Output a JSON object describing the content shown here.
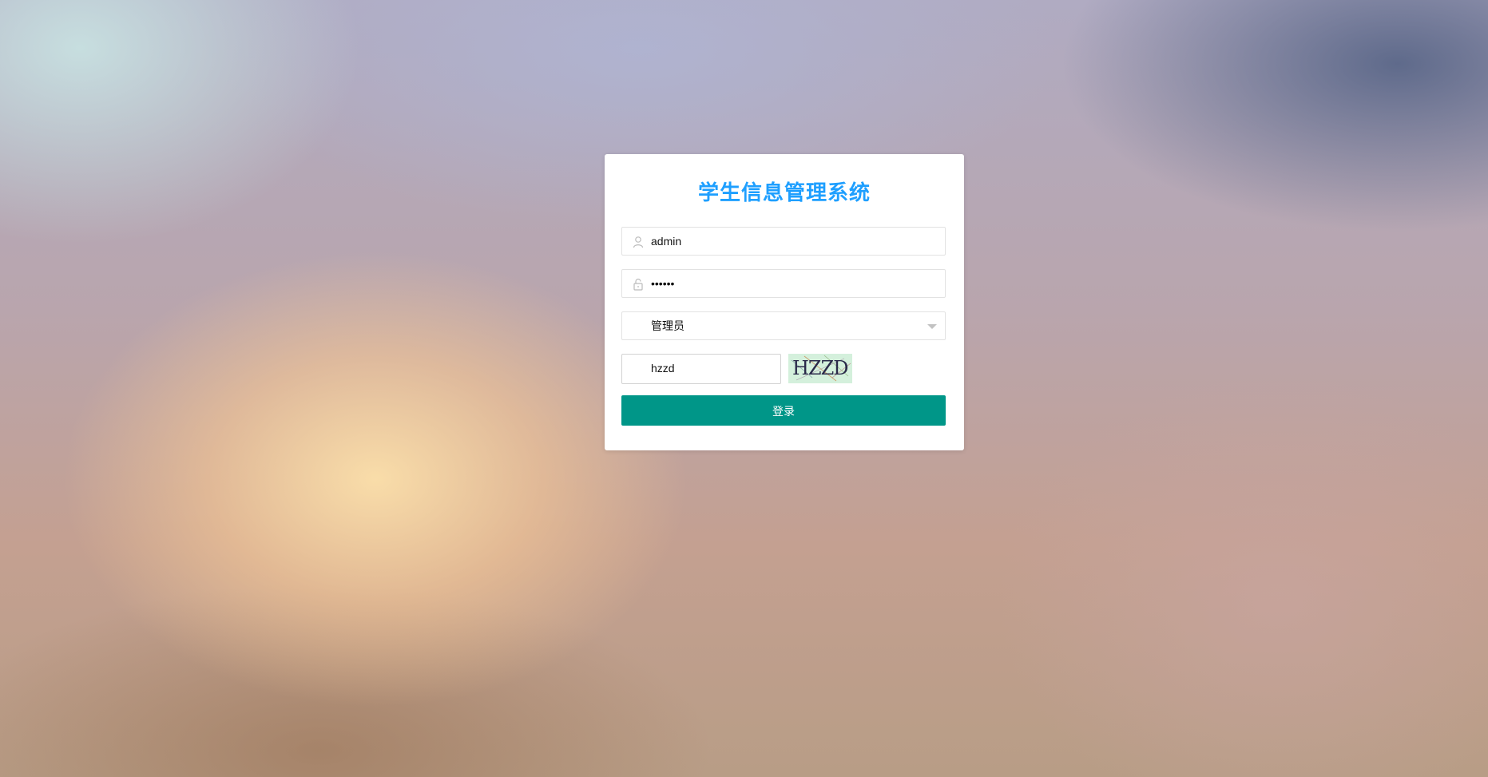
{
  "app": {
    "title": "学生信息管理系统"
  },
  "login_form": {
    "username": {
      "value": "admin",
      "icon": "user-icon"
    },
    "password": {
      "value": "••••••",
      "icon": "lock-icon"
    },
    "role_select": {
      "selected": "管理员",
      "icon": "chevron-down-icon"
    },
    "captcha": {
      "input_value": "hzzd",
      "image_text": "HZZD"
    },
    "submit_label": "登录"
  },
  "colors": {
    "title": "#1e9fff",
    "button": "#009688",
    "captcha_bg": "#d4f0dc"
  }
}
